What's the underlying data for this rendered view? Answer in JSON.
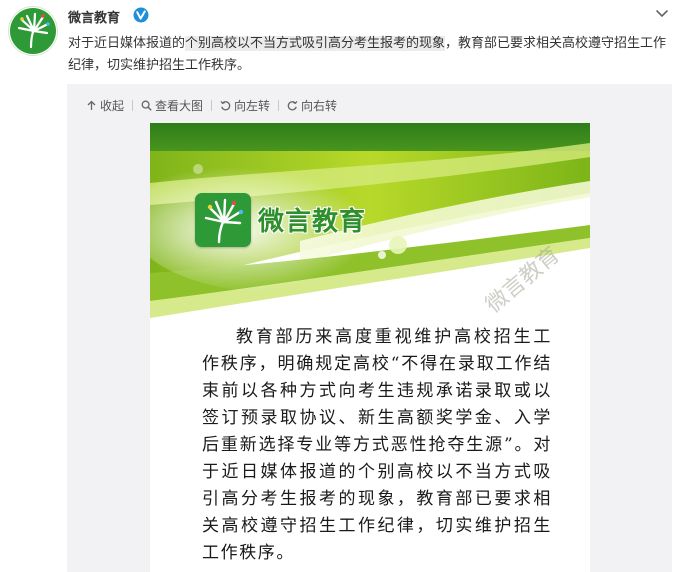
{
  "post": {
    "author": "微言教育",
    "text_before": "对于近日媒体报道的",
    "text_highlight": "个别高校以不当方式吸引高分考生报考的现象",
    "text_after": "，教育部已要求相关高校遵守招生工作纪律，切实维护招生工作秩序。"
  },
  "icons": {
    "verified": "verified-badge-icon",
    "more": "chevron-down-icon",
    "collapse": "arrow-up-icon",
    "view_large": "magnifier-icon",
    "rotate_left": "rotate-left-icon",
    "rotate_right": "rotate-right-icon"
  },
  "toolbar": {
    "collapse": "收起",
    "view_large": "查看大图",
    "rotate_left": "向左转",
    "rotate_right": "向右转"
  },
  "poster": {
    "logo_text": "微言教育",
    "watermark": "微言教育",
    "body": "教育部历来高度重视维护高校招生工作秩序，明确规定高校“不得在录取工作结束前以各种方式向考生违规承诺录取或以签订预录取协议、新生高额奖学金、入学后重新选择专业等方式恶性抢夺生源”。对于近日媒体报道的个别高校以不当方式吸引高分考生报考的现象，教育部已要求相关高校遵守招生工作纪律，切实维护招生工作秩序。"
  },
  "colors": {
    "brand_green": "#2e9a37",
    "verified_blue": "#1e8fd8",
    "poster_dark_green": "#2d7d1a",
    "poster_lime": "#a6cf1e"
  }
}
